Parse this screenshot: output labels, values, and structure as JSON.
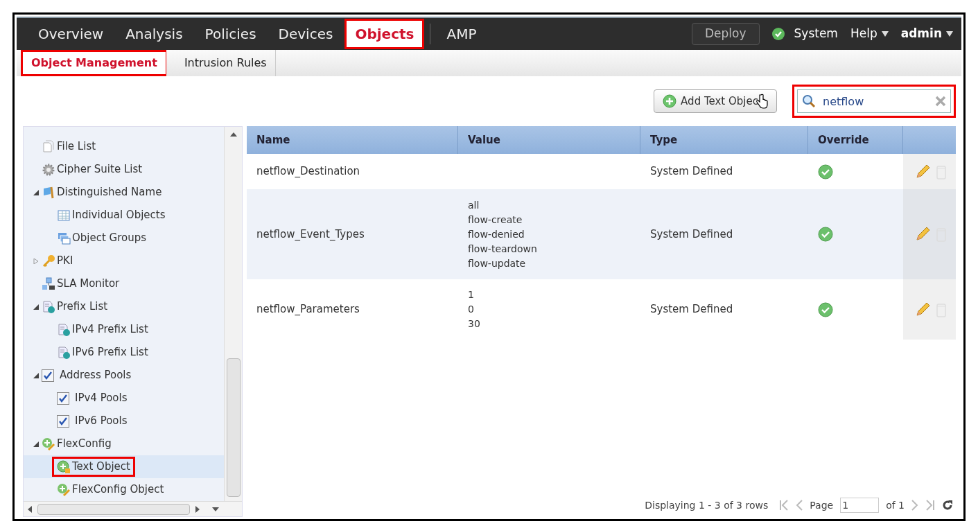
{
  "nav": {
    "tabs": [
      {
        "label": "Overview",
        "selected": false,
        "highlighted": false
      },
      {
        "label": "Analysis",
        "selected": false,
        "highlighted": false
      },
      {
        "label": "Policies",
        "selected": false,
        "highlighted": false
      },
      {
        "label": "Devices",
        "selected": false,
        "highlighted": false
      },
      {
        "label": "Objects",
        "selected": true,
        "highlighted": true
      },
      {
        "label": "AMP",
        "selected": false,
        "highlighted": false
      }
    ],
    "deploy": "Deploy",
    "menus": [
      {
        "label": "System",
        "dropdown": false,
        "bold": false
      },
      {
        "label": "Help",
        "dropdown": true,
        "bold": false
      },
      {
        "label": "admin",
        "dropdown": true,
        "bold": true
      }
    ]
  },
  "subtabs": [
    {
      "label": "Object Management",
      "selected": true,
      "highlighted": true
    },
    {
      "label": "Intrusion Rules",
      "selected": false,
      "highlighted": false
    }
  ],
  "toolbar": {
    "add_button": "Add Text Objec",
    "search": {
      "value": "netflow",
      "highlighted": true
    }
  },
  "sidebar": {
    "items": [
      {
        "label": "File List",
        "kind": "file"
      },
      {
        "label": "Cipher Suite List",
        "kind": "gear"
      },
      {
        "label": "Distinguished Name",
        "kind": "flag",
        "expanded": true,
        "children": [
          {
            "label": "Individual Objects",
            "kind": "table"
          },
          {
            "label": "Object Groups",
            "kind": "windows"
          }
        ]
      },
      {
        "label": "PKI",
        "kind": "key",
        "expanded": false
      },
      {
        "label": "SLA Monitor",
        "kind": "network"
      },
      {
        "label": "Prefix List",
        "kind": "doc",
        "expanded": true,
        "children": [
          {
            "label": "IPv4 Prefix List",
            "kind": "doc"
          },
          {
            "label": "IPv6 Prefix List",
            "kind": "doc"
          }
        ]
      },
      {
        "label": "Address Pools",
        "kind": "checkbox",
        "checked": true,
        "expanded": true,
        "children": [
          {
            "label": "IPv4 Pools",
            "kind": "checkbox",
            "checked": true
          },
          {
            "label": "IPv6 Pools",
            "kind": "checkbox",
            "checked": true
          }
        ]
      },
      {
        "label": "FlexConfig",
        "kind": "flex",
        "expanded": true,
        "children": [
          {
            "label": "Text Object",
            "kind": "textobj",
            "selected": true,
            "highlighted": true
          },
          {
            "label": "FlexConfig Object",
            "kind": "flex",
            "selected": false,
            "highlighted": false
          }
        ]
      }
    ]
  },
  "table": {
    "columns": [
      "Name",
      "Value",
      "Type",
      "Override"
    ],
    "rows": [
      {
        "name": "netflow_Destination",
        "value": [],
        "type": "System Defined",
        "override": true
      },
      {
        "name": "netflow_Event_Types",
        "value": [
          "all",
          "flow-create",
          "flow-denied",
          "flow-teardown",
          "flow-update"
        ],
        "type": "System Defined",
        "override": true
      },
      {
        "name": "netflow_Parameters",
        "value": [
          "1",
          "0",
          "30"
        ],
        "type": "System Defined",
        "override": true
      }
    ]
  },
  "pager": {
    "summary": "Displaying 1 - 3 of 3 rows",
    "page_label": "Page",
    "page": "1",
    "of": "of 1"
  }
}
